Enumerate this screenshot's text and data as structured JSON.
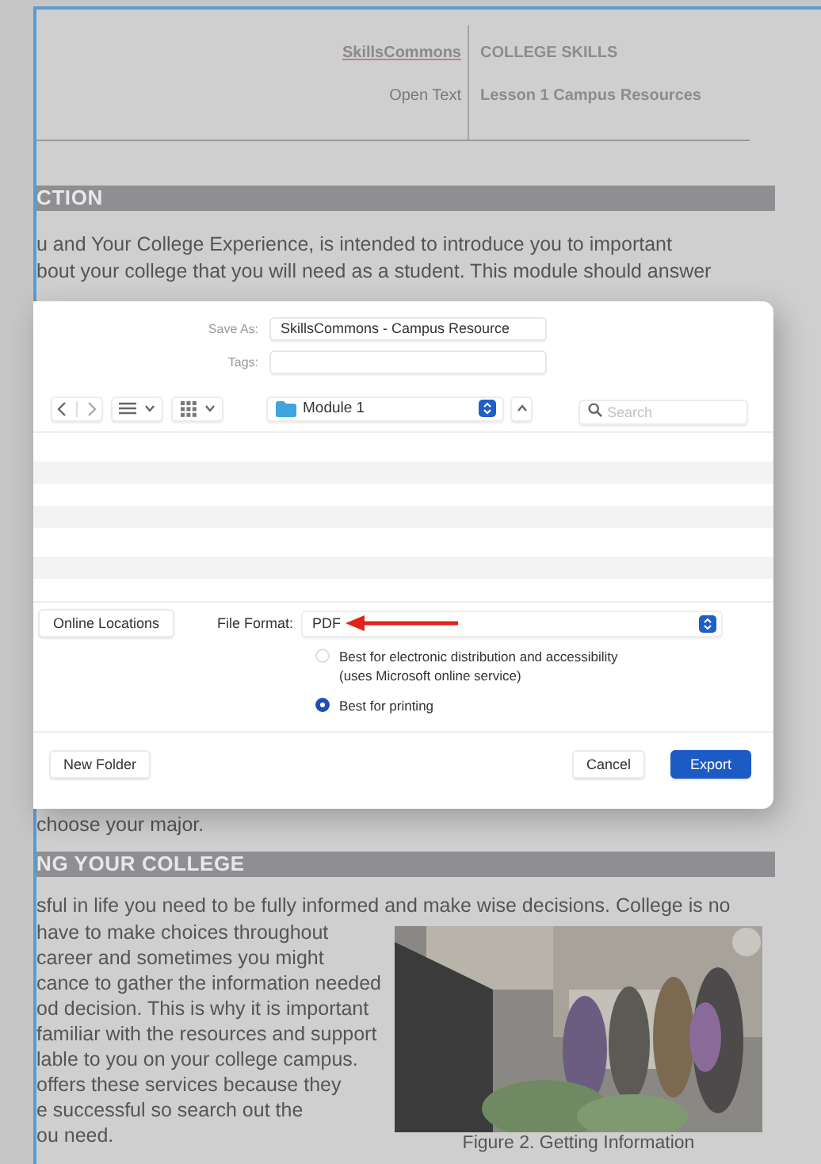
{
  "document": {
    "header": {
      "brand": "SkillsCommons",
      "brand_sub": "Open Text",
      "course": "COLLEGE SKILLS",
      "lesson": "Lesson 1 Campus Resources"
    },
    "sections": [
      {
        "heading": "CTION",
        "paragraphs": [
          "u and Your College Experience, is intended to introduce you to important\nbout your college that you will need as a student. This module should answer"
        ]
      },
      {
        "lead": "choose your major.",
        "heading": "NG YOUR  COLLEGE",
        "paragraphs": [
          "sful in life you need to be fully informed and make wise decisions. College is no"
        ],
        "column_text": " have to make choices throughout\ncareer and sometimes you might\ncance to gather the information needed\nod decision. This is why it is important\nfamiliar with the resources and support\nlable to you on your college campus.\noffers these services because they\ne successful so search out the\nou need.",
        "figure": {
          "kind": "picture",
          "caption": "Figure 2. Getting Information"
        }
      }
    ]
  },
  "dialog": {
    "save_as": {
      "label": "Save As:",
      "value": "SkillsCommons - Campus Resource"
    },
    "tags": {
      "label": "Tags:"
    },
    "location": "Module 1",
    "search": {
      "placeholder": "Search"
    },
    "online_locations": "Online Locations",
    "file_format": {
      "label": "File Format:",
      "value": "PDF"
    },
    "options": [
      {
        "label": "Best for electronic distribution and accessibility\n(uses Microsoft online service)",
        "selected": false
      },
      {
        "label": "Best for printing",
        "selected": true
      }
    ],
    "buttons": {
      "new_folder": "New Folder",
      "cancel": "Cancel",
      "export": "Export"
    }
  }
}
